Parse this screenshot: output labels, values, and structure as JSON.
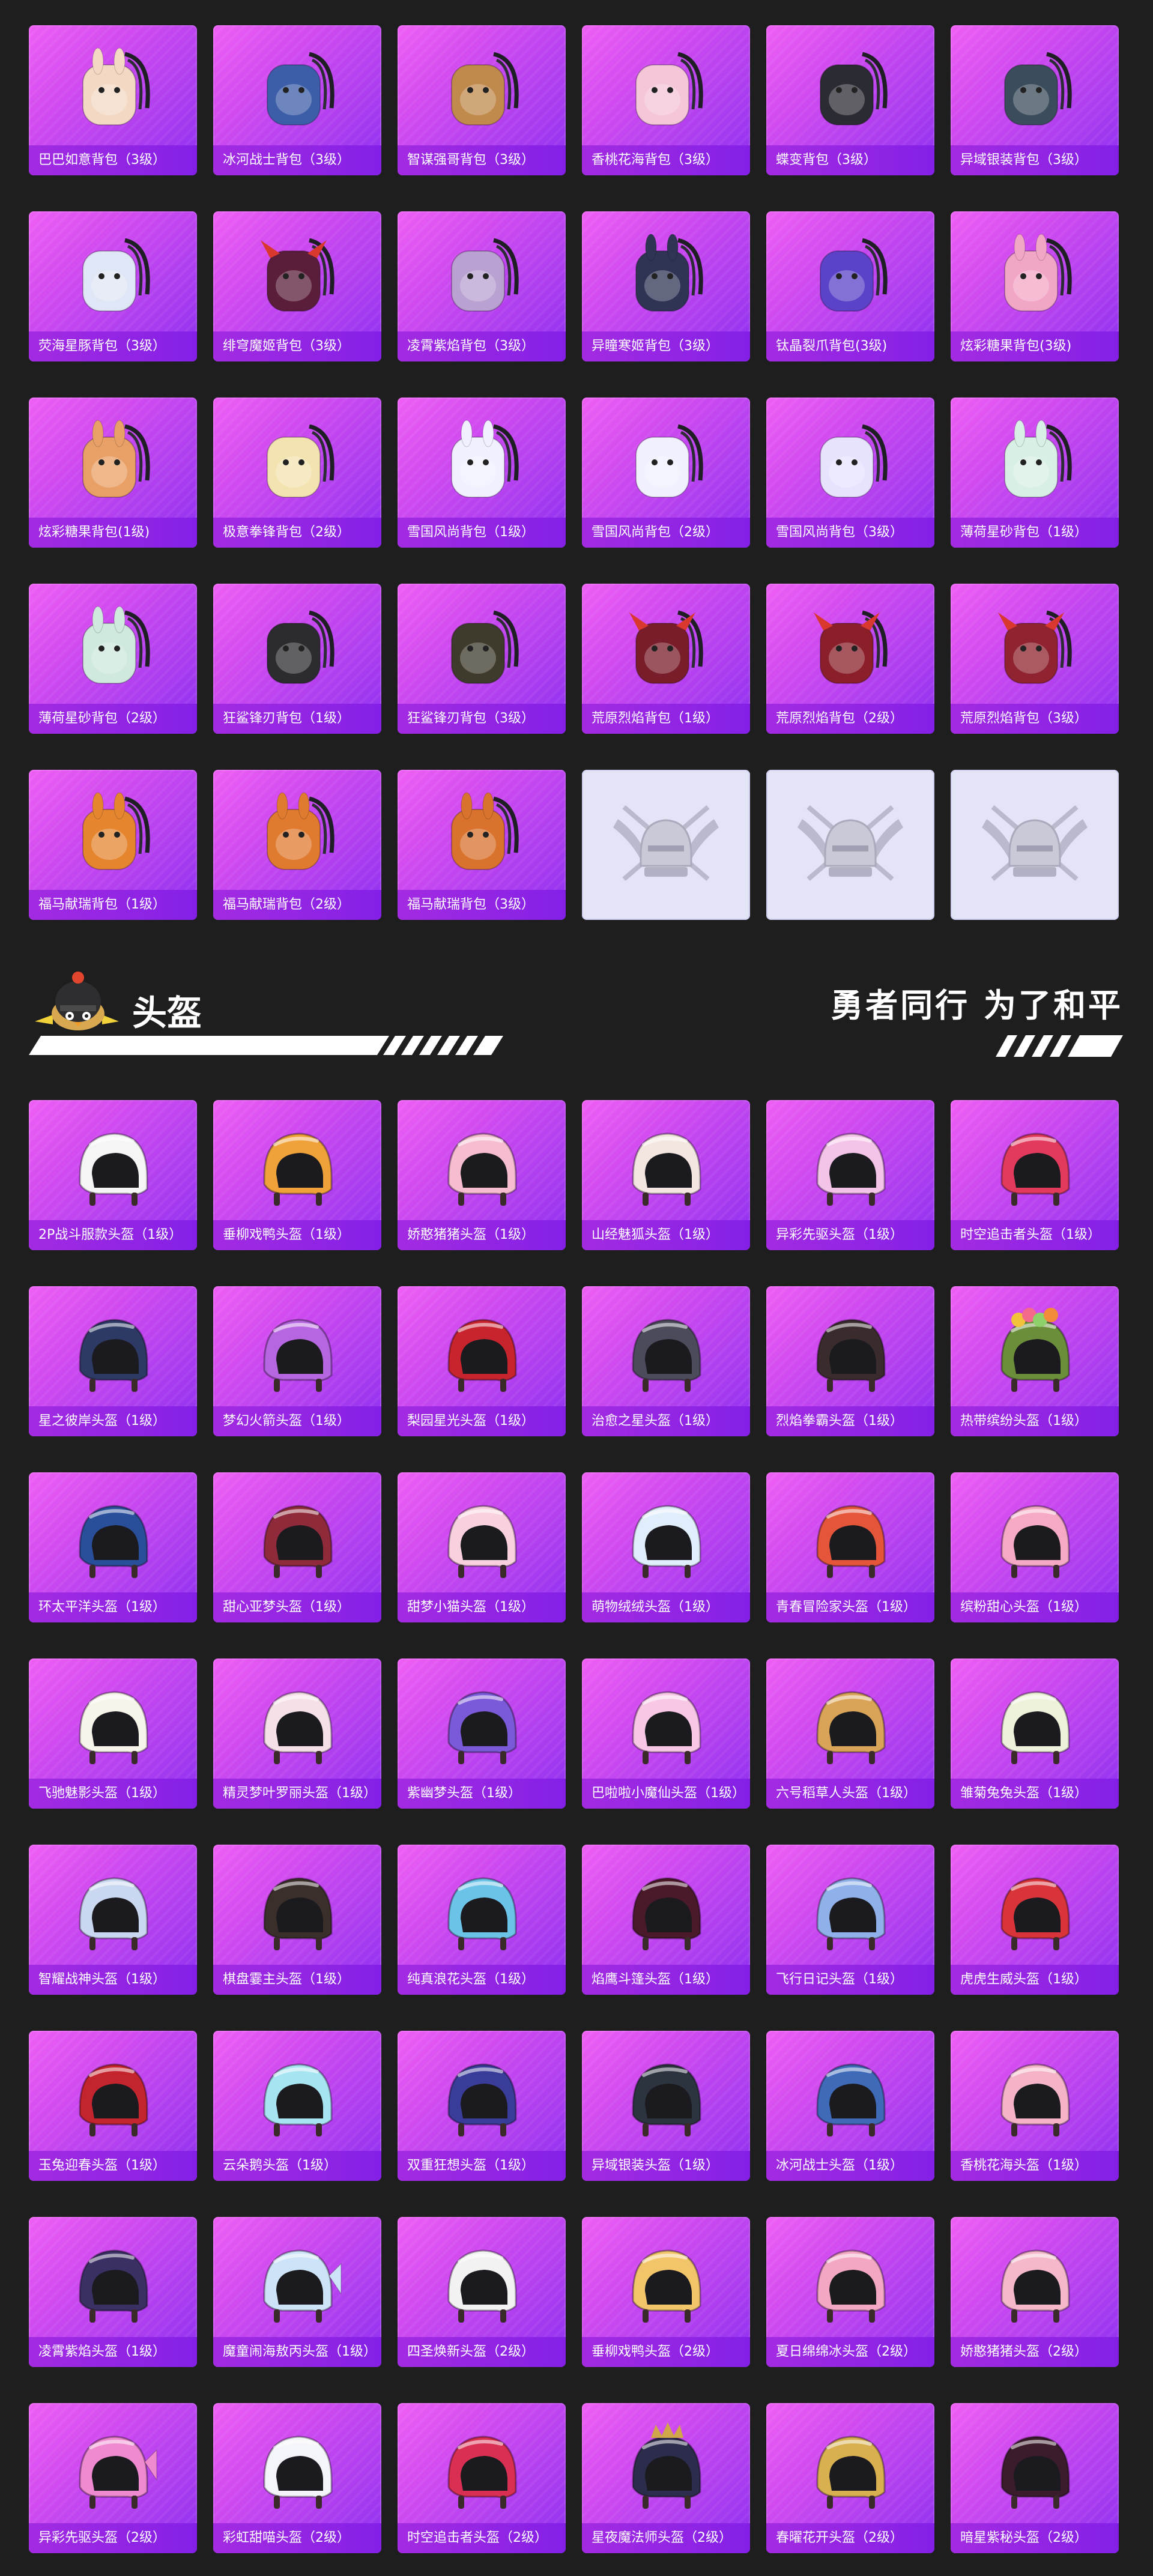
{
  "backpacks": [
    {
      "label": "巴巴如意背包（3级）",
      "icon": "bunny-bag",
      "color": "#f3d9c4"
    },
    {
      "label": "冰河战士背包（3级）",
      "icon": "blue-pack",
      "color": "#3c5ea8"
    },
    {
      "label": "智谋强哥背包（3级）",
      "icon": "bear-bag",
      "color": "#c08a4c"
    },
    {
      "label": "香桃花海背包（3级）",
      "icon": "flower-bag",
      "color": "#f5c5d8"
    },
    {
      "label": "蝶变背包（3级）",
      "icon": "butterfly-pack",
      "color": "#2b2b33"
    },
    {
      "label": "异域银装背包（3级）",
      "icon": "tech-pack",
      "color": "#3b4d5c"
    },
    {
      "label": "荧海星豚背包（3级）",
      "icon": "dolphin-bag",
      "color": "#dfe6f5"
    },
    {
      "label": "绯穹魔姬背包（3级）",
      "icon": "bat-bag",
      "color": "#5a1e3a"
    },
    {
      "label": "凌霄紫焰背包（3级）",
      "icon": "flame-bag",
      "color": "#b9a2d2"
    },
    {
      "label": "异瞳寒姬背包（3级）",
      "icon": "rabbit-bag",
      "color": "#2f3454"
    },
    {
      "label": "钛晶裂爪背包(3级)",
      "icon": "crystal-bag",
      "color": "#5b42c8"
    },
    {
      "label": "炫彩糖果背包(3级)",
      "icon": "donut-bag",
      "color": "#f2a6c6"
    },
    {
      "label": "炫彩糖果背包(1级)",
      "icon": "donut-bag",
      "color": "#e9a066"
    },
    {
      "label": "极意拳锋背包（2级）",
      "icon": "cup-bag",
      "color": "#f3e3b0"
    },
    {
      "label": "雪国风尚背包（1级）",
      "icon": "snow-bunny-bag",
      "color": "#f0f0ff"
    },
    {
      "label": "雪国风尚背包（2级）",
      "icon": "snow-penguin-bag",
      "color": "#f0f0ff"
    },
    {
      "label": "雪国风尚背包（3级）",
      "icon": "snow-penguin-bag",
      "color": "#e7e3ff"
    },
    {
      "label": "薄荷星砂背包（1级）",
      "icon": "mint-bag",
      "color": "#d7efe4"
    },
    {
      "label": "薄荷星砂背包（2级）",
      "icon": "mint-bag",
      "color": "#cfe9dd"
    },
    {
      "label": "狂鲨锋刃背包（1级）",
      "icon": "shark-bag",
      "color": "#2c2c30"
    },
    {
      "label": "狂鲨锋刃背包（3级）",
      "icon": "shark-bag",
      "color": "#3e3a2c"
    },
    {
      "label": "荒原烈焰背包（1级）",
      "icon": "horn-bag",
      "color": "#7a1d2a"
    },
    {
      "label": "荒原烈焰背包（2级）",
      "icon": "horn-bag",
      "color": "#8a1f2a"
    },
    {
      "label": "荒原烈焰背包（3级）",
      "icon": "horn-bag",
      "color": "#8f2330"
    },
    {
      "label": "福马献瑞背包（1级）",
      "icon": "horse-bag",
      "color": "#e5862f"
    },
    {
      "label": "福马献瑞背包（2级）",
      "icon": "horse-bag",
      "color": "#e07a2e"
    },
    {
      "label": "福马献瑞背包（3级）",
      "icon": "horse-bag",
      "color": "#d9722c"
    },
    {
      "label": "",
      "icon": "placeholder-emblem",
      "color": "#bfc0cf"
    },
    {
      "label": "",
      "icon": "placeholder-emblem",
      "color": "#bfc0cf"
    },
    {
      "label": "",
      "icon": "placeholder-emblem",
      "color": "#bfc0cf"
    }
  ],
  "section": {
    "title": "头盔",
    "slogan": "勇者同行 为了和平",
    "mascot_icon": "chick-helmet-mascot"
  },
  "helmets": [
    {
      "label": "2P战斗服款头盔（1级）",
      "icon": "helmet",
      "color": "#f5f5f5"
    },
    {
      "label": "垂柳戏鸭头盔（1级）",
      "icon": "helmet",
      "color": "#f0a23a"
    },
    {
      "label": "娇憨猪猪头盔（1级）",
      "icon": "helmet",
      "color": "#f6bdd0"
    },
    {
      "label": "山经魅狐头盔（1级）",
      "icon": "helmet",
      "color": "#f3e6e0"
    },
    {
      "label": "异彩先驱头盔（1级）",
      "icon": "helmet",
      "color": "#f4c4e8"
    },
    {
      "label": "时空追击者头盔（1级）",
      "icon": "helmet",
      "color": "#e23a5c"
    },
    {
      "label": "星之彼岸头盔（1级）",
      "icon": "helmet",
      "color": "#2e3a66"
    },
    {
      "label": "梦幻火箭头盔（1级）",
      "icon": "helmet",
      "color": "#b566e0"
    },
    {
      "label": "梨园星光头盔（1级）",
      "icon": "helmet",
      "color": "#c8242e"
    },
    {
      "label": "治愈之星头盔（1级）",
      "icon": "helmet",
      "color": "#4b4b5c"
    },
    {
      "label": "烈焰拳霸头盔（1级）",
      "icon": "helmet",
      "color": "#3a2c2c"
    },
    {
      "label": "热带缤纷头盔（1级）",
      "icon": "flower-helmet",
      "color": "#6b8e3a"
    },
    {
      "label": "环太平洋头盔（1级）",
      "icon": "helmet",
      "color": "#2a4f9a"
    },
    {
      "label": "甜心亚梦头盔（1级）",
      "icon": "helmet",
      "color": "#8e2a3a"
    },
    {
      "label": "甜梦小猫头盔（1级）",
      "icon": "helmet",
      "color": "#f8d0de"
    },
    {
      "label": "萌物绒绒头盔（1级）",
      "icon": "helmet",
      "color": "#dfeefa"
    },
    {
      "label": "青春冒险家头盔（1级）",
      "icon": "helmet",
      "color": "#e5553a"
    },
    {
      "label": "缤粉甜心头盔（1级）",
      "icon": "helmet",
      "color": "#f5a9c4"
    },
    {
      "label": "飞驰魅影头盔（1级）",
      "icon": "helmet",
      "color": "#f7f4ea"
    },
    {
      "label": "精灵梦叶罗丽头盔（1级）",
      "icon": "helmet",
      "color": "#f5e0e8"
    },
    {
      "label": "紫幽梦头盔（1级）",
      "icon": "helmet",
      "color": "#7a5ad8"
    },
    {
      "label": "巴啦啦小魔仙头盔（1级）",
      "icon": "helmet",
      "color": "#f8c7e6"
    },
    {
      "label": "六号稻草人头盔（1级）",
      "icon": "straw-helmet",
      "color": "#d9a458"
    },
    {
      "label": "雏菊兔兔头盔（1级）",
      "icon": "helmet",
      "color": "#eef2da"
    },
    {
      "label": "智耀战神头盔（1级）",
      "icon": "helmet",
      "color": "#c9d8f0"
    },
    {
      "label": "棋盘霎主头盔（1级）",
      "icon": "helmet",
      "color": "#3a2f2a"
    },
    {
      "label": "纯真浪花头盔（1级）",
      "icon": "helmet",
      "color": "#6bc3e8"
    },
    {
      "label": "焰鹰斗篷头盔（1级）",
      "icon": "helmet",
      "color": "#4a1a2a"
    },
    {
      "label": "飞行日记头盔（1级）",
      "icon": "helmet",
      "color": "#8fb0e8"
    },
    {
      "label": "虎虎生威头盔（1级）",
      "icon": "helmet",
      "color": "#d8343a"
    },
    {
      "label": "玉兔迎春头盔（1级）",
      "icon": "helmet",
      "color": "#c4242e"
    },
    {
      "label": "云朵鹅头盔（1级）",
      "icon": "helmet",
      "color": "#a6e4f2"
    },
    {
      "label": "双重狂想头盔（1级）",
      "icon": "helmet",
      "color": "#3a3c9a"
    },
    {
      "label": "异域银装头盔（1级）",
      "icon": "helmet",
      "color": "#2c3440"
    },
    {
      "label": "冰河战士头盔（1级）",
      "icon": "helmet",
      "color": "#3e6ab8"
    },
    {
      "label": "香桃花海头盔（1级）",
      "icon": "helmet",
      "color": "#f4b3c6"
    },
    {
      "label": "凌霄紫焰头盔（1级）",
      "icon": "helmet",
      "color": "#3a3064"
    },
    {
      "label": "魔童闹海敖丙头盔（1级）",
      "icon": "fish-helmet",
      "color": "#cde3f7"
    },
    {
      "label": "四圣焕新头盔（2级）",
      "icon": "helmet",
      "color": "#f2f2f2"
    },
    {
      "label": "垂柳戏鸭头盔（2级）",
      "icon": "helmet",
      "color": "#f3c56a"
    },
    {
      "label": "夏日绵绵冰头盔（2级）",
      "icon": "helmet",
      "color": "#f3a7c4"
    },
    {
      "label": "娇憨猪猪头盔（2级）",
      "icon": "helmet",
      "color": "#f4b8ca"
    },
    {
      "label": "异彩先驱头盔（2级）",
      "icon": "fish-helmet",
      "color": "#f08ad0"
    },
    {
      "label": "彩虹甜喵头盔（2级）",
      "icon": "helmet",
      "color": "#f4f4fb"
    },
    {
      "label": "时空追击者头盔（2级）",
      "icon": "helmet",
      "color": "#d92f52"
    },
    {
      "label": "星夜魔法师头盔（2级）",
      "icon": "crown-helmet",
      "color": "#2c2c4c"
    },
    {
      "label": "春曜花开头盔（2级）",
      "icon": "helmet",
      "color": "#d8b050"
    },
    {
      "label": "暗星紫秘头盔（2级）",
      "icon": "helmet",
      "color": "#3a1c2c"
    }
  ]
}
